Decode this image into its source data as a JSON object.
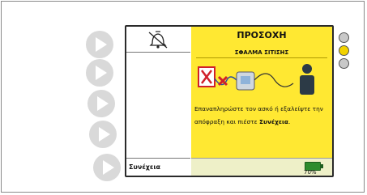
{
  "screen": {
    "alarm_title": "ΠΡΟΣΟΧΗ",
    "alarm_subtitle": "ΣΦΑΛΜΑ ΣΙΤΙΣΗΣ",
    "message_part1": "Επαναπληρώστε τον ασκό ή εξαλείψτε την απόφραξη και πιέστε ",
    "message_bold": "Συνέχεια",
    "message_end": ".",
    "soft_key_label": "Συνέχεια",
    "battery_percent": "70%",
    "alarm_silence_icon": "alarm-silenced-bell-icon"
  },
  "side_buttons": [
    "play-button-1",
    "play-button-2",
    "play-button-3",
    "play-button-4",
    "play-button-5"
  ],
  "leds": [
    {
      "name": "led-top",
      "color": "#c8c8c8"
    },
    {
      "name": "led-middle",
      "color": "#f2d200"
    },
    {
      "name": "led-bottom",
      "color": "#c8c8c8"
    }
  ],
  "colors": {
    "alarm_background": "#ffe832",
    "error_red": "#d0202a",
    "battery_green": "#2e8c2e"
  }
}
